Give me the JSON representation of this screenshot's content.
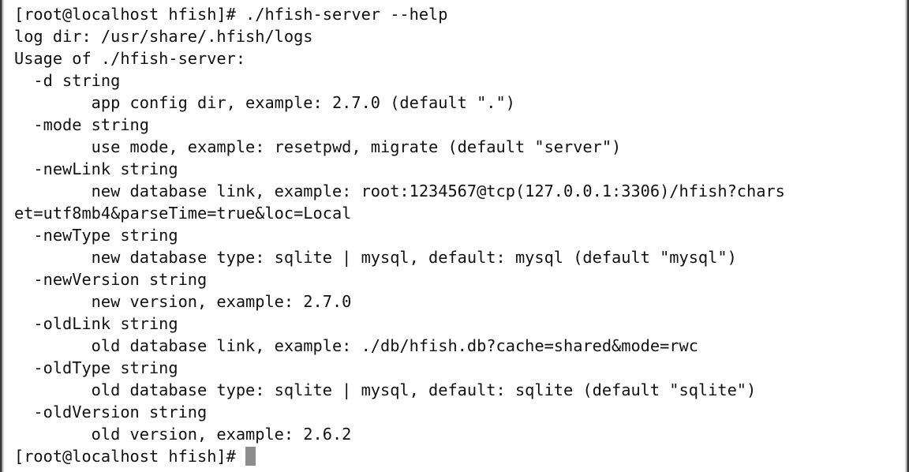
{
  "terminal": {
    "lines": [
      "[root@localhost hfish]# ./hfish-server --help",
      "log dir: /usr/share/.hfish/logs",
      "Usage of ./hfish-server:",
      "  -d string",
      "        app config dir, example: 2.7.0 (default \".\")",
      "  -mode string",
      "        use mode, example: resetpwd, migrate (default \"server\")",
      "  -newLink string",
      "        new database link, example: root:1234567@tcp(127.0.0.1:3306)/hfish?chars",
      "et=utf8mb4&parseTime=true&loc=Local",
      "  -newType string",
      "        new database type: sqlite | mysql, default: mysql (default \"mysql\")",
      "  -newVersion string",
      "        new version, example: 2.7.0",
      "  -oldLink string",
      "        old database link, example: ./db/hfish.db?cache=shared&mode=rwc",
      "  -oldType string",
      "        old database type: sqlite | mysql, default: sqlite (default \"sqlite\")",
      "  -oldVersion string",
      "        old version, example: 2.6.2"
    ],
    "prompt": "[root@localhost hfish]#"
  }
}
